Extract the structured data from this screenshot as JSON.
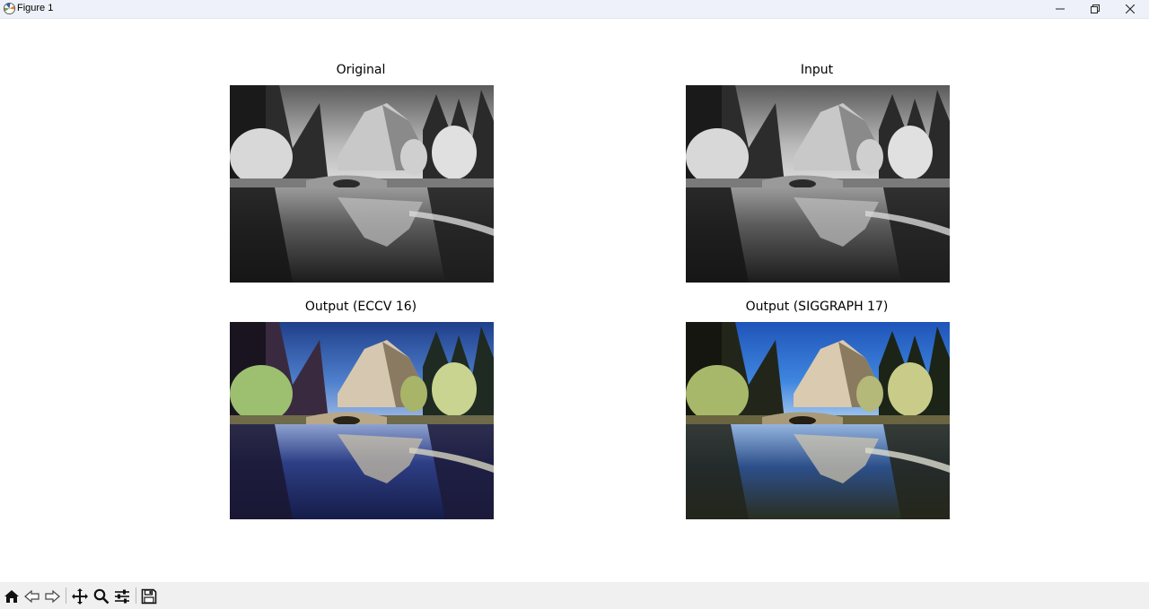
{
  "window": {
    "title": "Figure 1",
    "controls": [
      "minimize-icon",
      "restore-icon",
      "close-icon"
    ]
  },
  "figure": {
    "panels": [
      {
        "title": "Original",
        "image": "grayscale landscape photo"
      },
      {
        "title": "Input",
        "image": "grayscale landscape photo"
      },
      {
        "title": "Output (ECCV 16)",
        "image": "colorized landscape photo"
      },
      {
        "title": "Output (SIGGRAPH 17)",
        "image": "colorized landscape photo"
      }
    ]
  },
  "toolbar": {
    "buttons": [
      "home-icon",
      "back-icon",
      "forward-icon",
      "pan-icon",
      "zoom-icon",
      "configure-subplots-icon",
      "save-icon"
    ]
  },
  "colors": {
    "titlebar_bg": "#eef1f9",
    "toolbar_bg": "#f0f0f0",
    "sky_eccv": "#3f6fc8",
    "sky_siggraph": "#2f6fd0"
  }
}
